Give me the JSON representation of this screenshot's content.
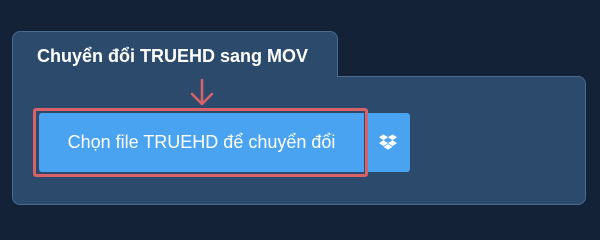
{
  "converter": {
    "tab_title": "Chuyển đổi TRUEHD sang MOV",
    "choose_file_label": "Chọn file TRUEHD để chuyển đổi",
    "dropbox_icon": "dropbox-icon",
    "pointer_icon": "arrow-down-icon",
    "colors": {
      "page_background": "#132236",
      "panel_background": "#2c4a6c",
      "button": "#4aa3f0",
      "highlight": "#d9626a"
    }
  }
}
